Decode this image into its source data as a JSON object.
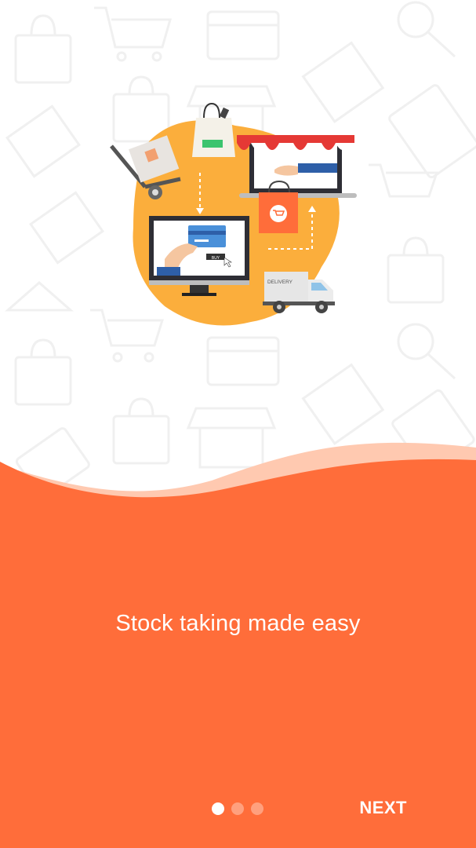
{
  "onboarding": {
    "title": "Stock taking made easy",
    "next_label": "NEXT",
    "page_indicator": {
      "current": 1,
      "total": 3
    }
  },
  "illustration": {
    "truck_label": "DELIVERY",
    "card_button_label": "BUY"
  },
  "colors": {
    "primary_orange": "#FF6D3A",
    "wave_light": "#FFC9B0",
    "illustration_blob": "#FBAE3C",
    "pattern_stroke": "#F0F0F0"
  },
  "icons": [
    "shopping-bag-icon",
    "cart-icon",
    "gift-icon",
    "magnifier-icon",
    "shop-icon",
    "hanger-icon",
    "card-icon"
  ]
}
